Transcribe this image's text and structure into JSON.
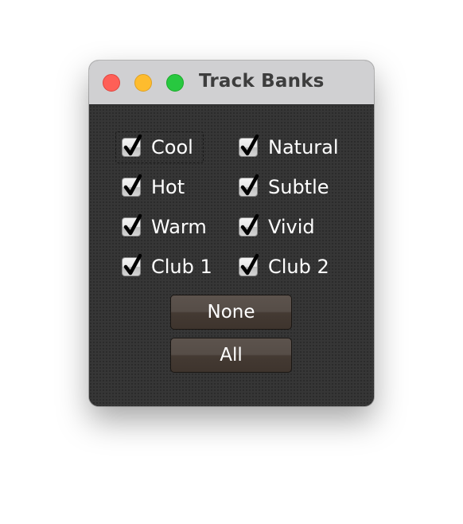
{
  "window": {
    "title": "Track Banks",
    "controls": {
      "close": "close-button",
      "minimize": "minimize-button",
      "zoom": "zoom-button"
    }
  },
  "checkboxes": [
    {
      "label": "Cool",
      "checked": true,
      "focused": true
    },
    {
      "label": "Natural",
      "checked": true,
      "focused": false
    },
    {
      "label": "Hot",
      "checked": true,
      "focused": false
    },
    {
      "label": "Subtle",
      "checked": true,
      "focused": false
    },
    {
      "label": "Warm",
      "checked": true,
      "focused": false
    },
    {
      "label": "Vivid",
      "checked": true,
      "focused": false
    },
    {
      "label": "Club 1",
      "checked": true,
      "focused": false
    },
    {
      "label": "Club 2",
      "checked": true,
      "focused": false
    }
  ],
  "buttons": {
    "none_label": "None",
    "all_label": "All"
  },
  "colors": {
    "close": "#fe5f57",
    "minimize": "#febc2e",
    "zoom": "#28c840",
    "panel": "#363636",
    "titlebar": "#d0d0d2"
  }
}
